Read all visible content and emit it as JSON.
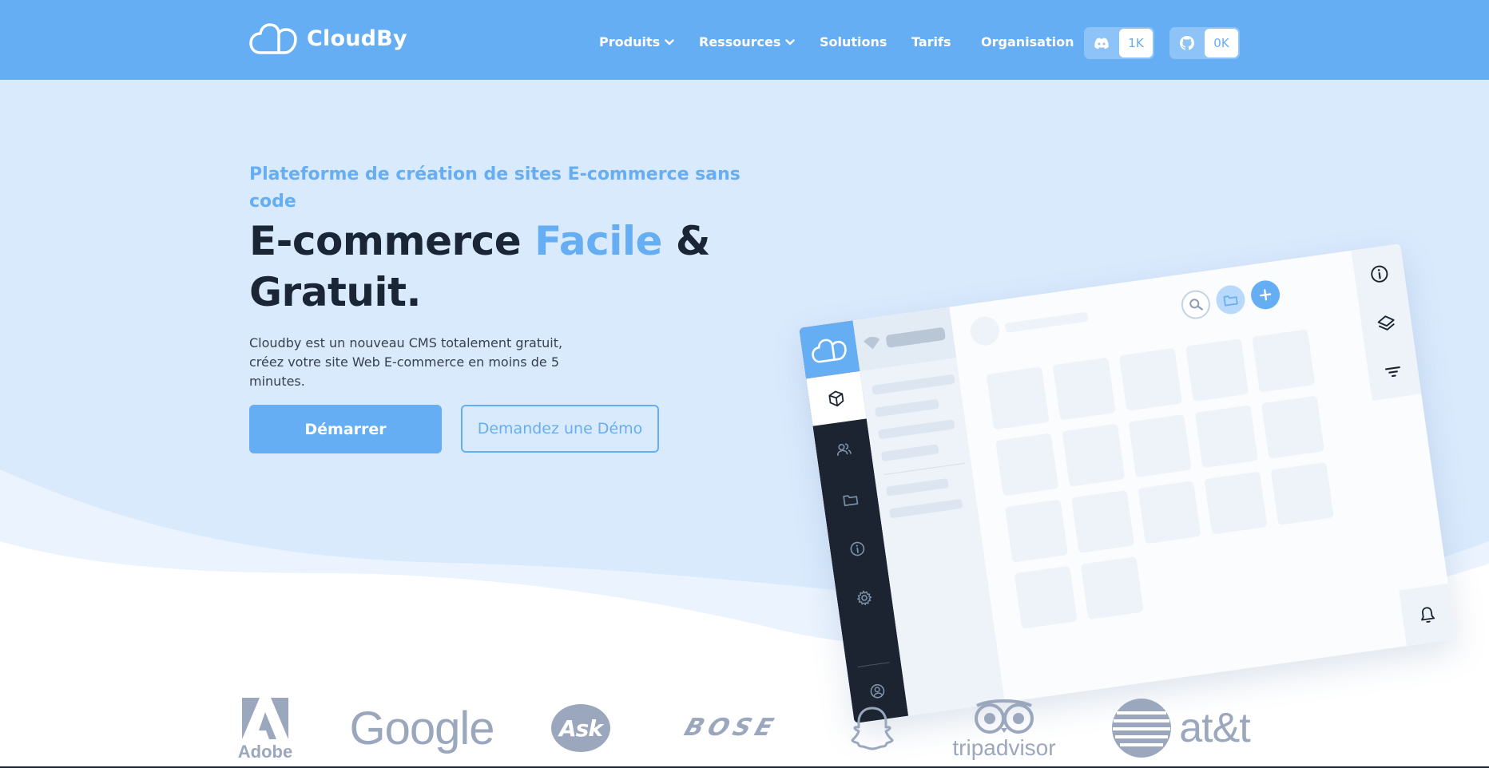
{
  "brand": {
    "name": "CloudBy"
  },
  "nav": {
    "items": [
      {
        "label": "Produits",
        "has_dropdown": true
      },
      {
        "label": "Ressources",
        "has_dropdown": true
      },
      {
        "label": "Solutions",
        "has_dropdown": false
      },
      {
        "label": "Tarifs",
        "has_dropdown": false
      },
      {
        "label": "Organisation",
        "has_dropdown": false
      }
    ],
    "discord": {
      "icon": "discord-icon",
      "count": "1K"
    },
    "github": {
      "icon": "github-icon",
      "count": "0K"
    }
  },
  "hero": {
    "eyebrow": "Plateforme de création de sites E-commerce sans code",
    "headline_part1": "E-commerce ",
    "headline_accent": "Facile",
    "headline_part2": " &",
    "headline_line2": "Gratuit.",
    "subtext": "Cloudby est un nouveau CMS totalement gratuit, créez votre site Web E-commerce en moins de 5 minutes.",
    "primary_button": "Démarrer",
    "secondary_button": "Demandez une Démo"
  },
  "mockup": {
    "rail_icons": [
      "cube-icon",
      "users-icon",
      "folder-icon",
      "info-icon",
      "settings-icon",
      "user-circle-icon"
    ],
    "toolbar_icons": [
      "search-icon",
      "folder-icon",
      "plus-icon"
    ],
    "right_icons": [
      "info-icon",
      "layers-icon",
      "filter-icon",
      "bell-icon"
    ]
  },
  "logos": {
    "adobe": "Adobe",
    "google": "Google",
    "ask": "Ask",
    "bose": "BOSE",
    "snapchat": "snapchat-ghost-icon",
    "tripadvisor": "tripadvisor",
    "att": "at&t"
  },
  "colors": {
    "primary": "#66aef3",
    "hero_bg": "#daeafd",
    "dark": "#1a2536",
    "logo_gray": "#9aa7bd"
  }
}
